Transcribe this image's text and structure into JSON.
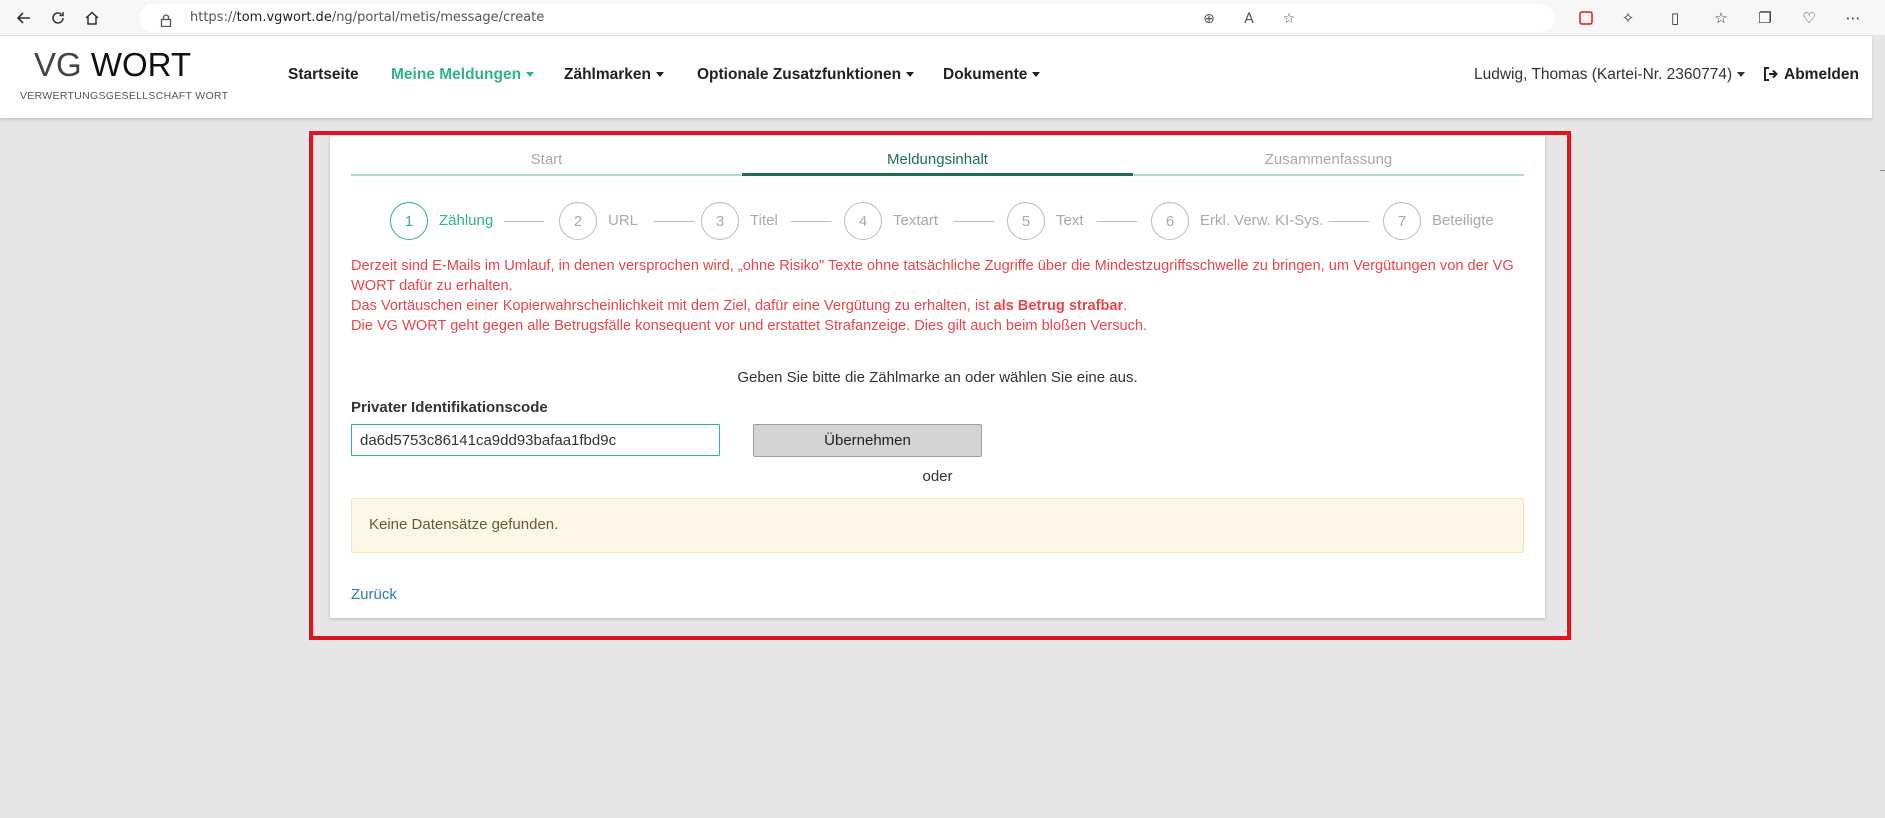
{
  "browser": {
    "url_prefix": "https://",
    "url_host": "tom.vgwort.de",
    "url_path": "/ng/portal/metis/message/create"
  },
  "header": {
    "logo_vg": "VG",
    "logo_wort": "WORT",
    "logo_sub": "VERWERTUNGSGESELLSCHAFT WORT",
    "nav": [
      {
        "label": "Startseite"
      },
      {
        "label": "Meine Meldungen"
      },
      {
        "label": "Zählmarken"
      },
      {
        "label": "Optionale Zusatzfunktionen"
      },
      {
        "label": "Dokumente"
      }
    ],
    "user": "Ludwig, Thomas (Kartei-Nr. 2360774)",
    "logout": "Abmelden"
  },
  "wizard": {
    "tabs": [
      {
        "label": "Start"
      },
      {
        "label": "Meldungsinhalt"
      },
      {
        "label": "Zusammenfassung"
      }
    ],
    "active_tab": 1,
    "steps": [
      {
        "num": "1",
        "label": "Zählung"
      },
      {
        "num": "2",
        "label": "URL"
      },
      {
        "num": "3",
        "label": "Titel"
      },
      {
        "num": "4",
        "label": "Textart"
      },
      {
        "num": "5",
        "label": "Text"
      },
      {
        "num": "6",
        "label": "Erkl. Verw. KI-Sys."
      },
      {
        "num": "7",
        "label": "Beteiligte"
      }
    ],
    "active_step": 0
  },
  "warning": {
    "line1": "Derzeit sind E-Mails im Umlauf, in denen versprochen wird, „ohne Risiko\" Texte ohne tatsächliche Zugriffe über die Mindestzugriffsschwelle zu bringen, um Vergütungen von der VG WORT dafür zu erhalten.",
    "line2_pre": "Das Vortäuschen einer Kopierwahrscheinlichkeit mit dem Ziel, dafür eine Vergütung zu erhalten, ist ",
    "line2_bold": "als Betrug strafbar",
    "line2_post": ".",
    "line3": "Die VG WORT geht gegen alle Betrugsfälle konsequent vor und erstattet Strafanzeige. Dies gilt auch beim bloßen Versuch."
  },
  "form": {
    "prompt": "Geben Sie bitte die Zählmarke an oder wählen Sie eine aus.",
    "code_label": "Privater Identifikationscode",
    "code_value": "da6d5753c86141ca9dd93bafaa1fbd9c",
    "apply_label": "Übernehmen",
    "or_label": "oder",
    "no_records": "Keine Datensätze gefunden.",
    "back_label": "Zurück"
  },
  "colors": {
    "accent": "#2eb38b",
    "dark_accent": "#1d6f5a",
    "warning_text": "#e8464b",
    "highlight_frame": "#e0141e",
    "info_bg": "#fcf7e6",
    "link": "#2b7cb3"
  }
}
